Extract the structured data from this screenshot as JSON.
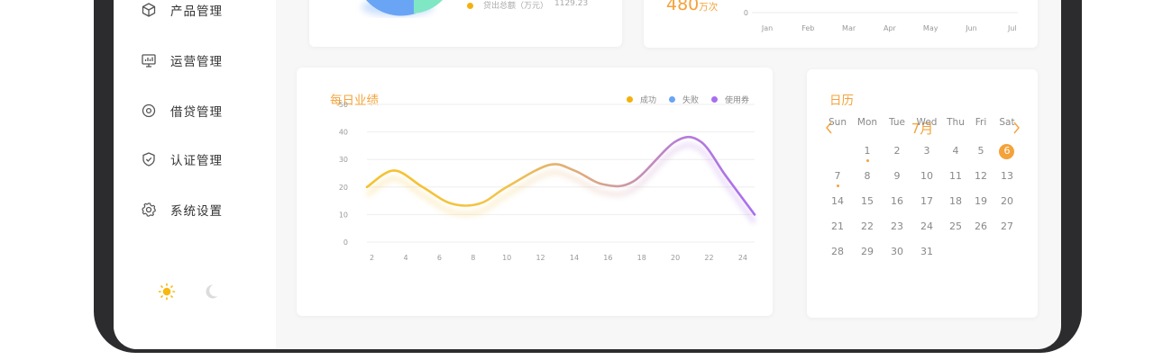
{
  "colors": {
    "accent": "#f4a23a",
    "success": "#f4b10c",
    "failure": "#6aa5f5",
    "coupon": "#a86ef0"
  },
  "sidebar": {
    "items": [
      {
        "label": "产品管理",
        "icon": "cube-icon"
      },
      {
        "label": "运营管理",
        "icon": "monitor-chart-icon"
      },
      {
        "label": "借贷管理",
        "icon": "target-icon"
      },
      {
        "label": "认证管理",
        "icon": "shield-check-icon"
      },
      {
        "label": "系统设置",
        "icon": "gear-icon"
      }
    ],
    "theme": {
      "light_icon": "sun-icon",
      "dark_icon": "moon-icon"
    }
  },
  "pie_card": {
    "legend_label": "贷出总额（万元）",
    "legend_value": "1129.23"
  },
  "top_chart": {
    "stat_value": "480",
    "stat_unit": "万次",
    "y_tick": "0",
    "x_ticks": [
      "Jan",
      "Feb",
      "Mar",
      "Apr",
      "May",
      "Jun",
      "Jul"
    ]
  },
  "daily": {
    "title": "每日业绩",
    "legend": [
      {
        "name": "成功",
        "color": "#f4b10c"
      },
      {
        "name": "失败",
        "color": "#6aa5f5"
      },
      {
        "name": "使用券",
        "color": "#a86ef0"
      }
    ]
  },
  "chart_data": {
    "type": "line",
    "title": "每日业绩",
    "x": [
      2,
      4,
      6,
      8,
      10,
      12,
      14,
      16,
      18,
      20,
      22,
      24
    ],
    "x_range": [
      1.7,
      24.7
    ],
    "ylim": [
      0,
      50
    ],
    "y_ticks": [
      0,
      10,
      20,
      30,
      40,
      50
    ],
    "grid": true,
    "legend_position": "top-right",
    "series": [
      {
        "name": "使用券",
        "points": [
          [
            1.7,
            20
          ],
          [
            3.3,
            26
          ],
          [
            5,
            20
          ],
          [
            6.7,
            14
          ],
          [
            8.4,
            14
          ],
          [
            10,
            20
          ],
          [
            12.5,
            28
          ],
          [
            14,
            26
          ],
          [
            15.7,
            21
          ],
          [
            17.5,
            22
          ],
          [
            20,
            36.5
          ],
          [
            21.5,
            36.5
          ],
          [
            23,
            24
          ],
          [
            24.7,
            10
          ]
        ]
      }
    ]
  },
  "calendar": {
    "title": "日历",
    "month": "7月",
    "prev_icon": "chevron-left-icon",
    "next_icon": "chevron-right-icon",
    "weekdays": [
      "Sun",
      "Mon",
      "Tue",
      "Wed",
      "Thu",
      "Fri",
      "Sat"
    ],
    "days": [
      [
        "",
        "1",
        "2",
        "3",
        "4",
        "5",
        "6"
      ],
      [
        "7",
        "8",
        "9",
        "10",
        "11",
        "12",
        "13"
      ],
      [
        "14",
        "15",
        "16",
        "17",
        "18",
        "19",
        "20"
      ],
      [
        "21",
        "22",
        "23",
        "24",
        "25",
        "26",
        "27"
      ],
      [
        "28",
        "29",
        "30",
        "31",
        "",
        "",
        ""
      ]
    ],
    "today": "6",
    "marked": [
      "1",
      "7"
    ]
  }
}
